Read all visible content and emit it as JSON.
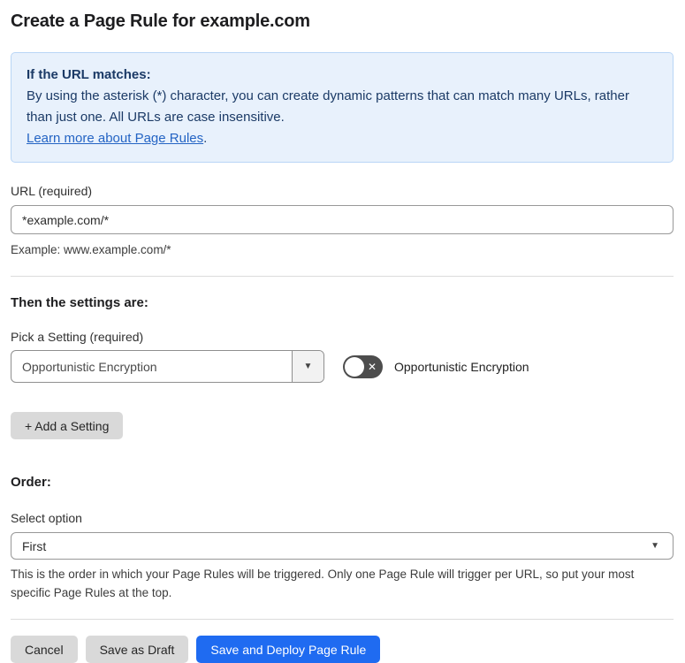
{
  "page": {
    "title": "Create a Page Rule for example.com"
  },
  "info_box": {
    "heading": "If the URL matches:",
    "body": "By using the asterisk (*) character, you can create dynamic patterns that can match many URLs, rather than just one. All URLs are case insensitive.",
    "link": "Learn more about Page Rules",
    "link_suffix": "."
  },
  "url_field": {
    "label": "URL (required)",
    "value": "*example.com/*",
    "helper": "Example: www.example.com/*"
  },
  "settings_section": {
    "heading": "Then the settings are:",
    "picker_label": "Pick a Setting (required)",
    "picker_value": "Opportunistic Encryption",
    "toggle_label": "Opportunistic Encryption",
    "toggle_state": "off",
    "toggle_glyph": "✕",
    "add_button_label": "+ Add a Setting",
    "dropdown_arrow": "▼"
  },
  "order_section": {
    "heading": "Order:",
    "select_label": "Select option",
    "select_value": "First",
    "dropdown_arrow": "▼",
    "helper": "This is the order in which your Page Rules will be triggered. Only one Page Rule will trigger per URL, so put your most specific Page Rules at the top."
  },
  "footer": {
    "cancel_label": "Cancel",
    "save_draft_label": "Save as Draft",
    "save_deploy_label": "Save and Deploy Page Rule"
  },
  "colors": {
    "primary_blue": "#1f6bf1",
    "info_bg": "#e8f1fc",
    "info_border": "#b9d5f6",
    "info_text": "#1b3a66",
    "link_blue": "#2464c4",
    "toggle_off_bg": "#4d4d4d",
    "button_gray": "#d9d9d9"
  }
}
